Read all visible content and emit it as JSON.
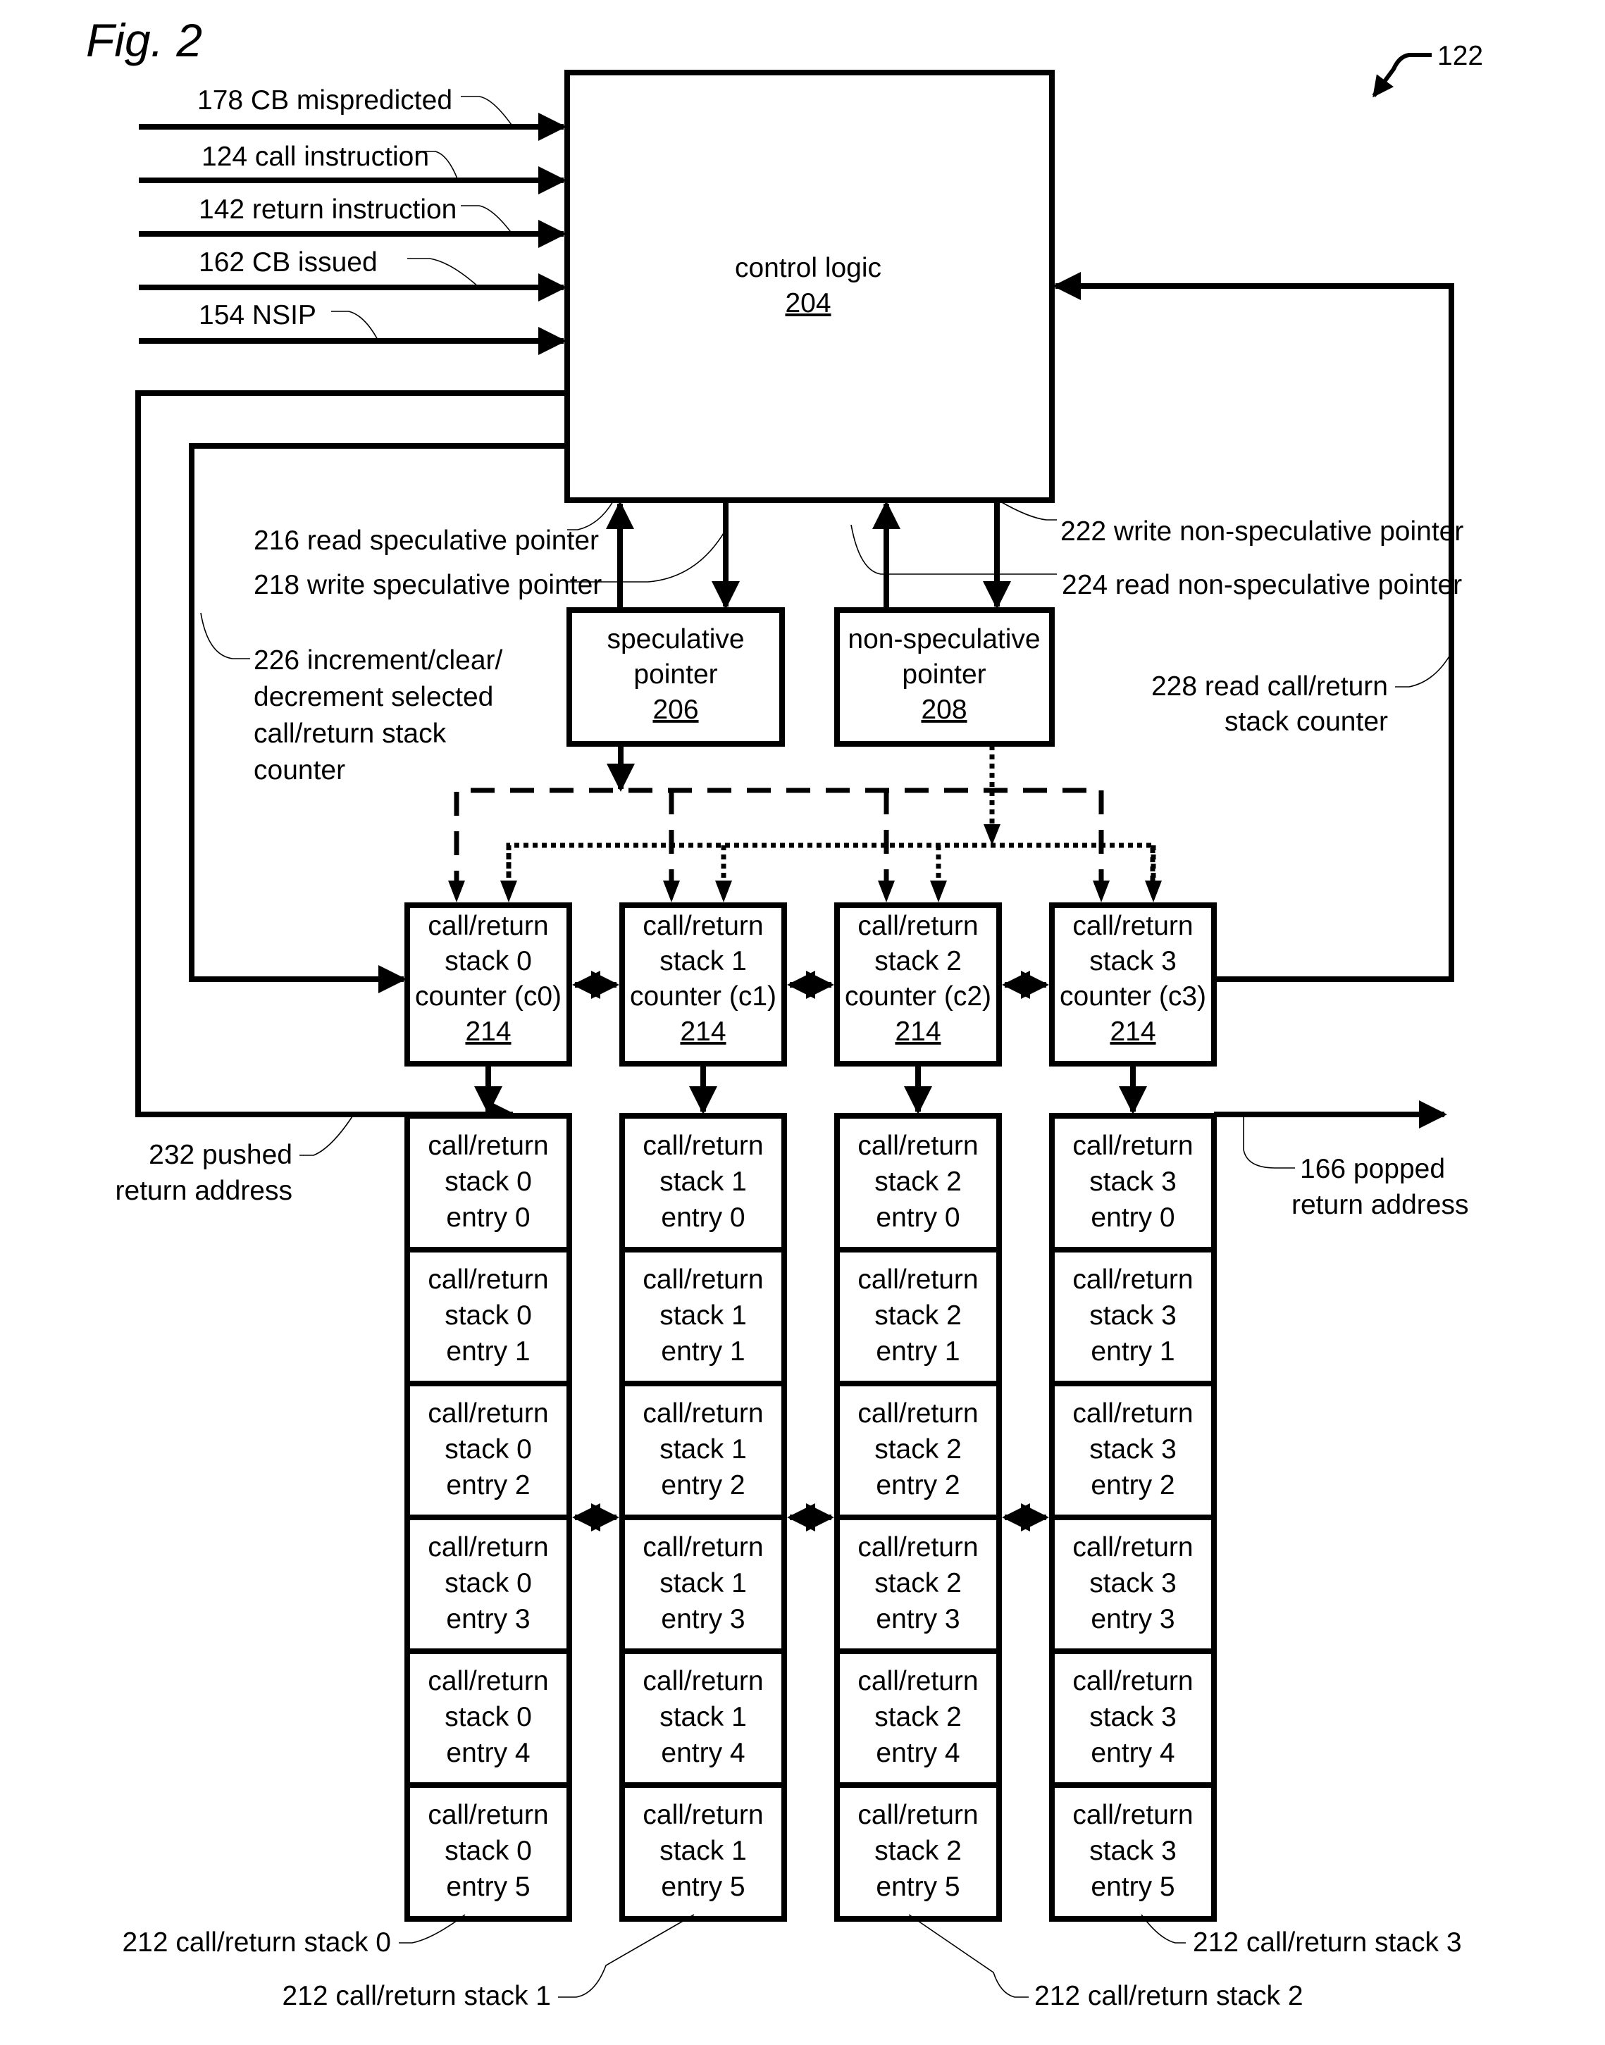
{
  "figure": {
    "title": "Fig. 2",
    "ref_number": "122"
  },
  "inputs": [
    {
      "label": "178 CB mispredicted"
    },
    {
      "label": "124 call instruction"
    },
    {
      "label": "142 return instruction"
    },
    {
      "label": "162 CB issued"
    },
    {
      "label": "154 NSIP"
    }
  ],
  "control_logic": {
    "name": "control logic",
    "ref": "204"
  },
  "speculative_pointer": {
    "line1": "speculative",
    "line2": "pointer",
    "ref": "206"
  },
  "non_speculative_pointer": {
    "line1": "non-speculative",
    "line2": "pointer",
    "ref": "208"
  },
  "signals": {
    "read_spec": "216 read speculative pointer",
    "write_spec": "218 write speculative pointer",
    "write_nonspec": "222 write non-speculative pointer",
    "read_nonspec": "224 read non-speculative pointer",
    "inc_clear_dec": [
      "226 increment/clear/",
      "decrement selected",
      "call/return stack",
      "counter"
    ],
    "read_counter": [
      "228 read call/return",
      "stack counter"
    ],
    "pushed": [
      "232 pushed",
      "return address"
    ],
    "popped": [
      "166 popped",
      "return address"
    ]
  },
  "counters": [
    {
      "line1": "call/return",
      "line2": "stack 0",
      "line3": "counter (c0)",
      "ref": "214"
    },
    {
      "line1": "call/return",
      "line2": "stack 1",
      "line3": "counter (c1)",
      "ref": "214"
    },
    {
      "line1": "call/return",
      "line2": "stack 2",
      "line3": "counter (c2)",
      "ref": "214"
    },
    {
      "line1": "call/return",
      "line2": "stack 3",
      "line3": "counter (c3)",
      "ref": "214"
    }
  ],
  "stacks": [
    {
      "label": "212 call/return stack 0",
      "entries": [
        [
          "call/return",
          "stack 0",
          "entry 0"
        ],
        [
          "call/return",
          "stack 0",
          "entry 1"
        ],
        [
          "call/return",
          "stack 0",
          "entry 2"
        ],
        [
          "call/return",
          "stack 0",
          "entry 3"
        ],
        [
          "call/return",
          "stack 0",
          "entry 4"
        ],
        [
          "call/return",
          "stack 0",
          "entry 5"
        ]
      ]
    },
    {
      "label": "212 call/return stack 1",
      "entries": [
        [
          "call/return",
          "stack 1",
          "entry 0"
        ],
        [
          "call/return",
          "stack 1",
          "entry 1"
        ],
        [
          "call/return",
          "stack 1",
          "entry 2"
        ],
        [
          "call/return",
          "stack 1",
          "entry 3"
        ],
        [
          "call/return",
          "stack 1",
          "entry 4"
        ],
        [
          "call/return",
          "stack 1",
          "entry 5"
        ]
      ]
    },
    {
      "label": "212 call/return stack 2",
      "entries": [
        [
          "call/return",
          "stack 2",
          "entry 0"
        ],
        [
          "call/return",
          "stack 2",
          "entry 1"
        ],
        [
          "call/return",
          "stack 2",
          "entry 2"
        ],
        [
          "call/return",
          "stack 2",
          "entry 3"
        ],
        [
          "call/return",
          "stack 2",
          "entry 4"
        ],
        [
          "call/return",
          "stack 2",
          "entry 5"
        ]
      ]
    },
    {
      "label": "212 call/return stack 3",
      "entries": [
        [
          "call/return",
          "stack 3",
          "entry 0"
        ],
        [
          "call/return",
          "stack 3",
          "entry 1"
        ],
        [
          "call/return",
          "stack 3",
          "entry 2"
        ],
        [
          "call/return",
          "stack 3",
          "entry 3"
        ],
        [
          "call/return",
          "stack 3",
          "entry 4"
        ],
        [
          "call/return",
          "stack 3",
          "entry 5"
        ]
      ]
    }
  ]
}
